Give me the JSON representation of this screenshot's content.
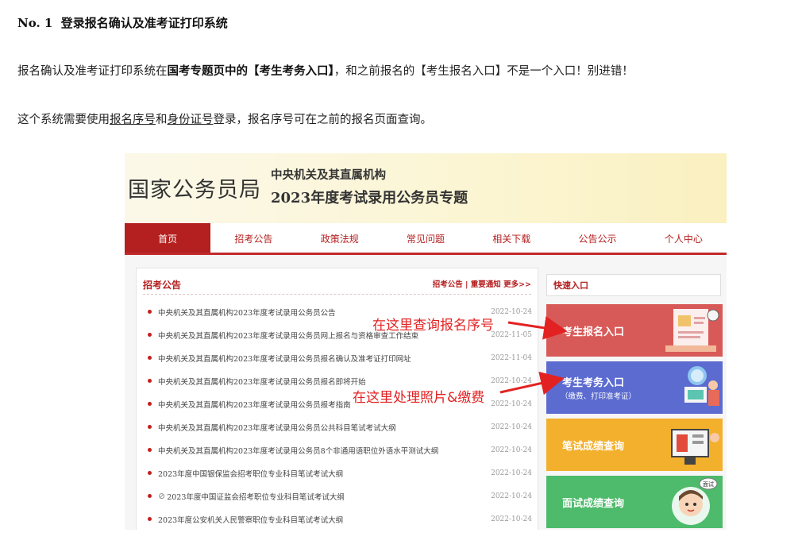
{
  "heading": {
    "number": "No. 1",
    "title": "登录报名确认及准考证打印系统"
  },
  "para1": {
    "part1": "报名确认及准考证打印系统在",
    "bold": "国考专题页中的【考生考务入口】",
    "part2": "，和之前报名的【考生报名入口】不是一个入口！别进错！"
  },
  "para2": {
    "part1": "这个系统需要使用",
    "link1": "报名序号",
    "part2": "和",
    "link2": "身份证号",
    "part3": "登录，报名序号可在之前的报名页面查询。"
  },
  "banner": {
    "logo": "国家公务员局",
    "sub1": "中央机关及其直属机构",
    "sub2": "2023年度考试录用公务员专题"
  },
  "nav": [
    {
      "label": "首页"
    },
    {
      "label": "招考公告"
    },
    {
      "label": "政策法规"
    },
    {
      "label": "常见问题"
    },
    {
      "label": "相关下载"
    },
    {
      "label": "公告公示"
    },
    {
      "label": "个人中心"
    }
  ],
  "left_panel": {
    "heading": "招考公告",
    "links": "招考公告 | 重要通知   更多>>",
    "items": [
      {
        "title": "中央机关及其直属机构2023年度考试录用公务员公告",
        "date": "2022-10-24"
      },
      {
        "title": "中央机关及其直属机构2023年度考试录用公务员网上报名与资格审查工作结束",
        "date": "2022-11-05"
      },
      {
        "title": "中央机关及其直属机构2023年度考试录用公务员报名确认及准考证打印网址",
        "date": "2022-11-04"
      },
      {
        "title": "中央机关及其直属机构2023年度考试录用公务员报名即将开始",
        "date": "2022-10-24"
      },
      {
        "title": "中央机关及其直属机构2023年度考试录用公务员报考指南",
        "date": "2022-10-24"
      },
      {
        "title": "中央机关及其直属机构2023年度考试录用公务员公共科目笔试考试大纲",
        "date": "2022-10-24"
      },
      {
        "title": "中央机关及其直属机构2023年度考试录用公务员8个非通用语职位外语水平测试大纲",
        "date": "2022-10-24"
      },
      {
        "title": "2023年度中国银保监会招考职位专业科目笔试考试大纲",
        "date": "2022-10-24"
      },
      {
        "title": "2023年度中国证监会招考职位专业科目笔试考试大纲",
        "date": "2022-10-24"
      },
      {
        "title": "2023年度公安机关人民警察职位专业科目笔试考试大纲",
        "date": "2022-10-24"
      }
    ]
  },
  "right_panel": {
    "heading": "快速入口",
    "entries": [
      {
        "label": "考生报名入口",
        "sub": ""
      },
      {
        "label": "考生考务入口",
        "sub": "（缴费、打印准考证）"
      },
      {
        "label": "笔试成绩查询",
        "sub": ""
      },
      {
        "label": "面试成绩查询",
        "sub": ""
      }
    ],
    "badge": "面试"
  },
  "annotations": {
    "a1": "在这里查询报名序号",
    "a2": "在这里处理照片&缴费"
  },
  "colors": {
    "brand_red": "#b3201f",
    "annotation_red": "#e22222",
    "qa_red": "#d85a58",
    "qa_blue": "#5b6bd0",
    "qa_orange": "#f2b02c",
    "qa_green": "#4dbb6b"
  }
}
